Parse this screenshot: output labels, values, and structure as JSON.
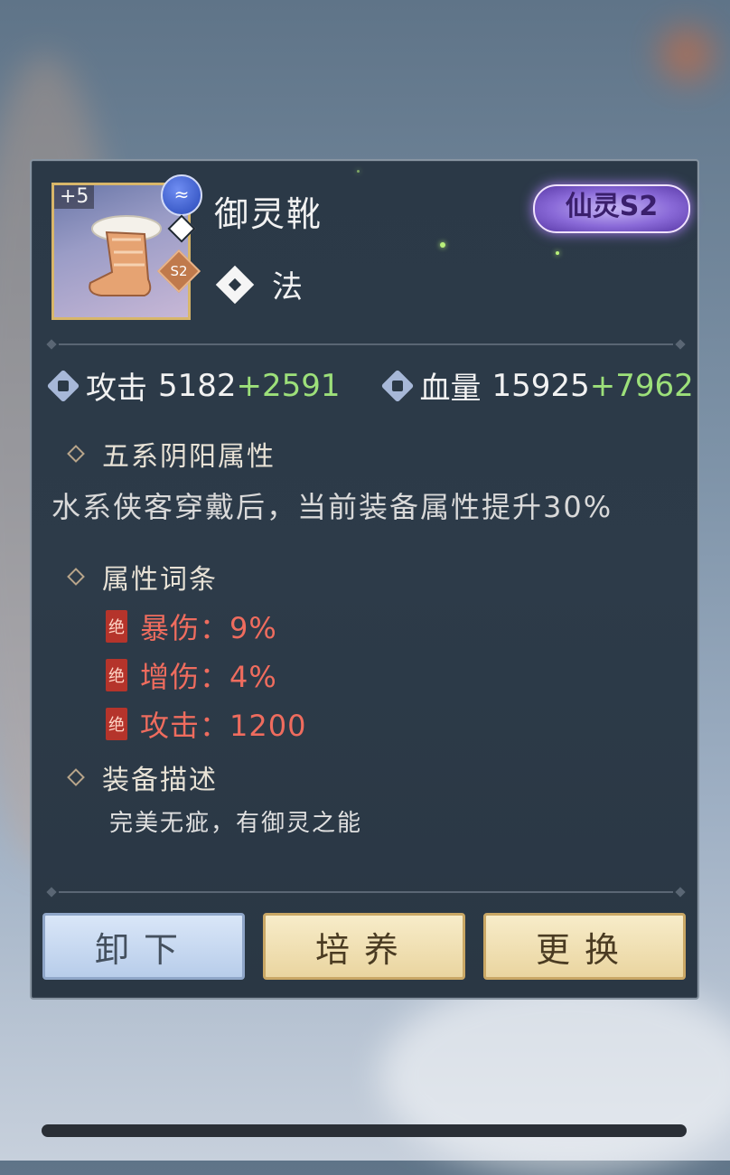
{
  "item": {
    "name": "御灵靴",
    "enhance_level": "+5",
    "tier_tag": "S2",
    "grade_badge": "仙灵S2",
    "class_label": "法"
  },
  "stats": {
    "attack_label": "攻击",
    "attack_base": "5182",
    "attack_bonus": "+2591",
    "hp_label": "血量",
    "hp_base": "15925",
    "hp_bonus": "+7962"
  },
  "sections": {
    "element_title": "五系阴阳属性",
    "element_desc": "水系侠客穿戴后，当前装备属性提升30%",
    "affix_title": "属性词条",
    "affixes": [
      {
        "tag": "绝",
        "text": "暴伤：9%"
      },
      {
        "tag": "绝",
        "text": "增伤：4%"
      },
      {
        "tag": "绝",
        "text": "攻击：1200"
      }
    ],
    "desc_title": "装备描述",
    "desc_text": "完美无疵，有御灵之能"
  },
  "buttons": {
    "unequip": "卸下",
    "upgrade": "培养",
    "replace": "更换"
  },
  "colors": {
    "panel_bg": "#2b3947",
    "bonus_green": "#9de07a",
    "affix_red": "#ef6c5e",
    "grade_purple": "#8a6ad8"
  }
}
